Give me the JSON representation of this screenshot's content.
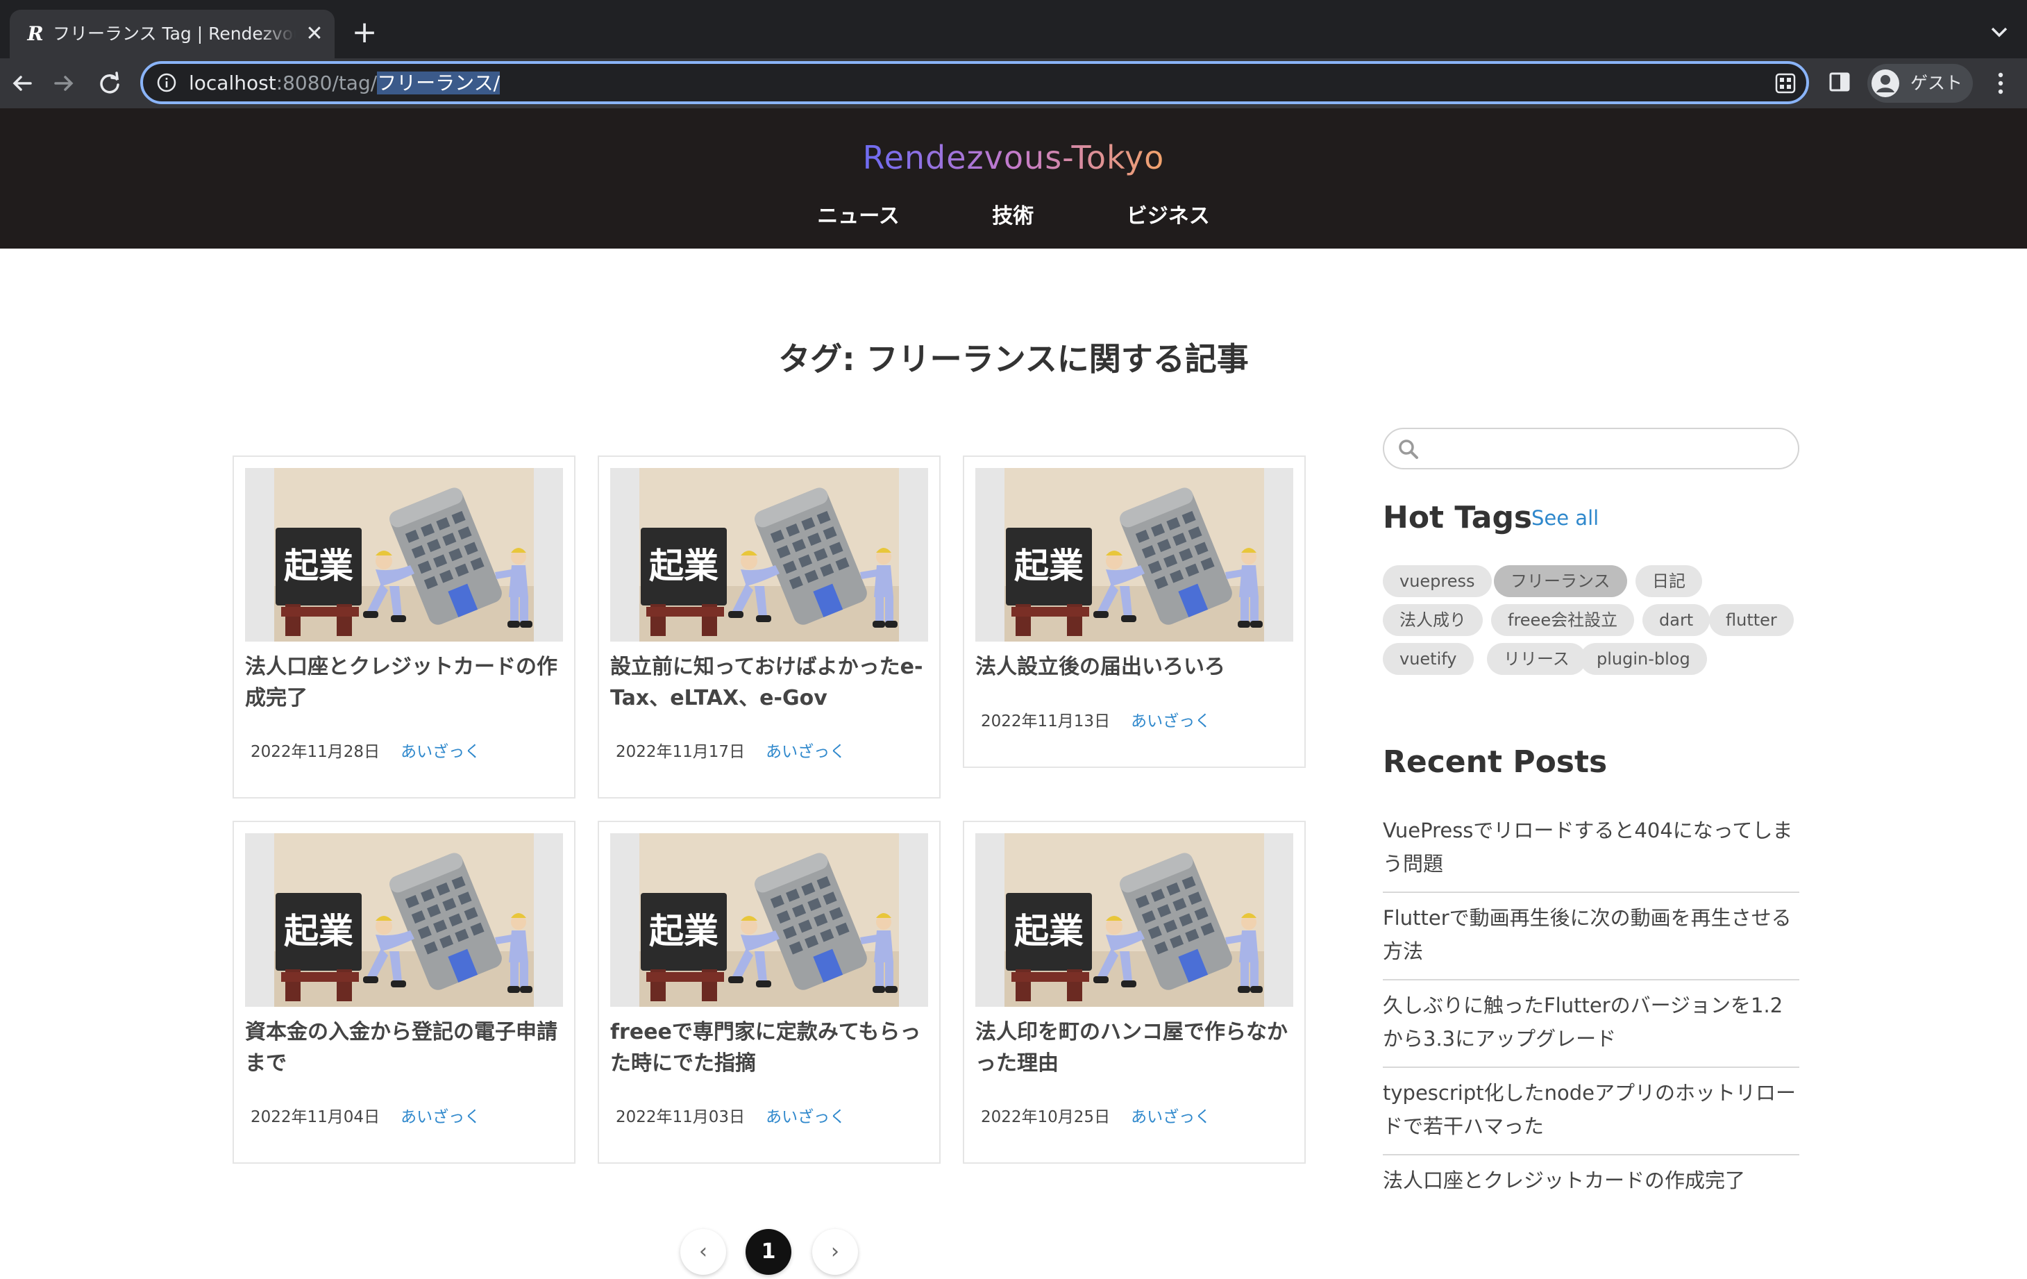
{
  "browser": {
    "tab_title": "フリーランス Tag | Rendezvous-Tokyo",
    "favicon": "R",
    "url_host": "localhost",
    "url_port_path": ":8080/tag/",
    "url_selected": "フリーランス/",
    "profile_name": "ゲスト"
  },
  "site": {
    "logo": "Rendezvous-Tokyo",
    "nav": [
      "ニュース",
      "技術",
      "ビジネス"
    ]
  },
  "page": {
    "heading": "タグ: フリーランスに関する記事"
  },
  "posts": [
    {
      "title": "法人口座とクレジットカードの作成完了",
      "date": "2022年11月28日",
      "author": "あいざっく",
      "thumb_text": "起業"
    },
    {
      "title": "設立前に知っておけばよかったe-Tax、eLTAX、e-Gov",
      "date": "2022年11月17日",
      "author": "あいざっく",
      "thumb_text": "起業"
    },
    {
      "title": "法人設立後の届出いろいろ",
      "date": "2022年11月13日",
      "author": "あいざっく",
      "thumb_text": "起業"
    },
    {
      "title": "資本金の入金から登記の電子申請まで",
      "date": "2022年11月04日",
      "author": "あいざっく",
      "thumb_text": "起業"
    },
    {
      "title": "freeeで専門家に定款みてもらった時にでた指摘",
      "date": "2022年11月03日",
      "author": "あいざっく",
      "thumb_text": "起業"
    },
    {
      "title": "法人印を町のハンコ屋で作らなかった理由",
      "date": "2022年10月25日",
      "author": "あいざっく",
      "thumb_text": "起業"
    }
  ],
  "pagination": {
    "prev": "‹",
    "current": "1",
    "next": "›"
  },
  "sidebar": {
    "search_placeholder": "",
    "hot_tags_title": "Hot Tags",
    "see_all": "See all",
    "tags": [
      "vuepress",
      "フリーランス",
      "日記",
      "法人成り",
      "freee会社設立",
      "dart",
      "flutter",
      "vuetify",
      "リリース",
      "plugin-blog"
    ],
    "active_tag": "フリーランス",
    "recent_title": "Recent Posts",
    "recent_posts": [
      "VuePressでリロードすると404になってしまう問題",
      "Flutterで動画再生後に次の動画を再生させる方法",
      "久しぶりに触ったFlutterのバージョンを1.2から3.3にアップグレード",
      "typescript化したnodeアプリのホットリロードで若干ハマった",
      "法人口座とクレジットカードの作成完了"
    ]
  },
  "colors": {
    "accent_link": "#2f88cc",
    "header_bg": "#201c1c",
    "focus_ring": "#8ab4f8"
  }
}
